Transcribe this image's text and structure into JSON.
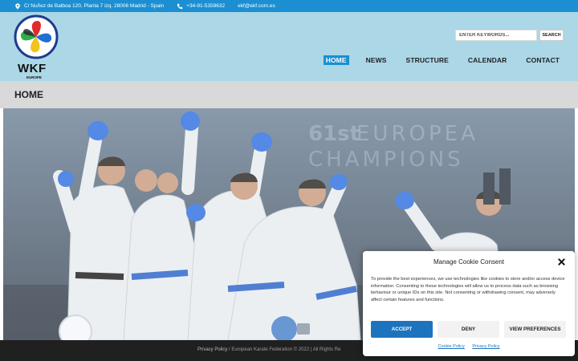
{
  "topbar": {
    "address": "C/ Nuñez de Balboa 120, Planta 7 izq. 28006 Madrid - Spain",
    "phone": "+34-91-5359632",
    "email": "ekf@ekf.com.es"
  },
  "logo": {
    "text": "WKF",
    "subtext": "EUROPE"
  },
  "search": {
    "placeholder": "ENTER KEYWORDS...",
    "button": "SEARCH"
  },
  "nav": {
    "items": [
      {
        "label": "HOME",
        "active": true
      },
      {
        "label": "NEWS",
        "active": false
      },
      {
        "label": "STRUCTURE",
        "active": false
      },
      {
        "label": "CALENDAR",
        "active": false
      },
      {
        "label": "CONTACT",
        "active": false
      }
    ]
  },
  "page": {
    "title": "HOME"
  },
  "hero": {
    "banner_number": "61st",
    "banner_line1": "EUROPEA",
    "banner_line2": "CHAMPIONS"
  },
  "footer": {
    "privacy_link": "Privacy Policy",
    "copyright": " / European Karate Federation © 2022 | All Rights Re"
  },
  "cookie": {
    "title": "Manage Cookie Consent",
    "body": "To provide the best experiences, we use technologies like cookies to store and/or access device information. Consenting to these technologies will allow us to process data such as browsing behaviour or unique IDs on this site. Not consenting or withdrawing consent, may adversely affect certain features and functions.",
    "accept": "ACCEPT",
    "deny": "DENY",
    "preferences": "VIEW PREFERENCES",
    "cookie_policy": "Cookie Policy",
    "privacy_policy": "Privacy Policy"
  },
  "colors": {
    "topbar": "#1b8fd1",
    "header": "#abd7e7",
    "nav_active": "#1b8fd1",
    "accept_button": "#1e73be",
    "footer": "#202020"
  }
}
